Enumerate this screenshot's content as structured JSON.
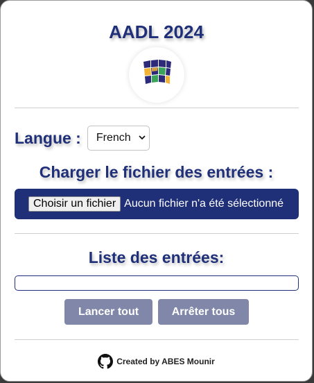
{
  "header": {
    "title": "AADL 2024"
  },
  "language": {
    "label": "Langue :",
    "selected": "French"
  },
  "upload": {
    "title": "Charger le fichier des entrées :",
    "button_label": "Choisir un fichier",
    "status": "Aucun fichier n'a été sélectionné"
  },
  "entries": {
    "title": "Liste des entrées:",
    "value": ""
  },
  "actions": {
    "start_all": "Lancer tout",
    "stop_all": "Arrêter tous"
  },
  "footer": {
    "credit": "Created by ABES Mounir",
    "icon": "github-icon"
  },
  "colors": {
    "primary": "#1f2f78",
    "button_disabled": "#8087a8"
  }
}
